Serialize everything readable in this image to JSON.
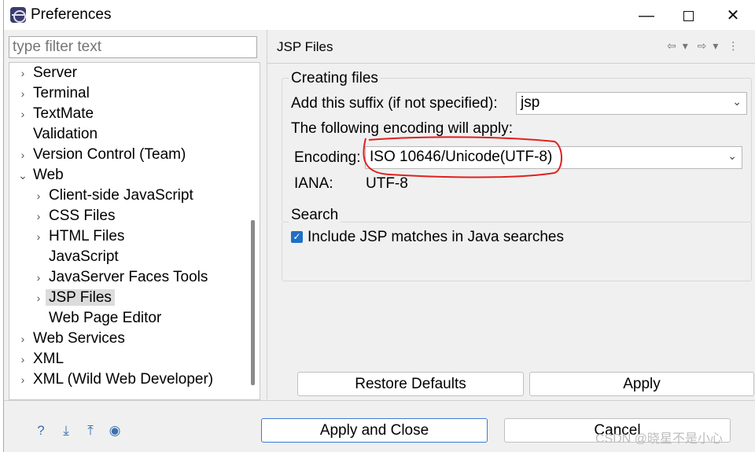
{
  "window": {
    "title": "Preferences"
  },
  "filter": {
    "placeholder": "type filter text"
  },
  "tree": [
    {
      "label": "Server",
      "expander": "›",
      "indent": 0
    },
    {
      "label": "Terminal",
      "expander": "›",
      "indent": 0
    },
    {
      "label": "TextMate",
      "expander": "›",
      "indent": 0
    },
    {
      "label": "Validation",
      "expander": "",
      "indent": 0
    },
    {
      "label": "Version Control (Team)",
      "expander": "›",
      "indent": 0
    },
    {
      "label": "Web",
      "expander": "⌄",
      "indent": 0
    },
    {
      "label": "Client-side JavaScript",
      "expander": "›",
      "indent": 1
    },
    {
      "label": "CSS Files",
      "expander": "›",
      "indent": 1
    },
    {
      "label": "HTML Files",
      "expander": "›",
      "indent": 1
    },
    {
      "label": "JavaScript",
      "expander": "",
      "indent": 1
    },
    {
      "label": "JavaServer Faces Tools",
      "expander": "›",
      "indent": 1
    },
    {
      "label": "JSP Files",
      "expander": "›",
      "indent": 1,
      "selected": true
    },
    {
      "label": "Web Page Editor",
      "expander": "",
      "indent": 1
    },
    {
      "label": "Web Services",
      "expander": "›",
      "indent": 0
    },
    {
      "label": "XML",
      "expander": "›",
      "indent": 0
    },
    {
      "label": "XML (Wild Web Developer)",
      "expander": "›",
      "indent": 0
    }
  ],
  "page": {
    "title": "JSP Files",
    "creating": {
      "group_label": "Creating files",
      "suffix_label": "Add this suffix (if not specified):",
      "suffix_value": "jsp",
      "encoding_intro": "The following encoding will apply:",
      "encoding_label": "Encoding:",
      "encoding_value": "ISO 10646/Unicode(UTF-8)",
      "iana_label": "IANA:",
      "iana_value": "UTF-8"
    },
    "search": {
      "group_label": "Search",
      "include_label": "Include JSP matches in Java searches",
      "include_checked": true
    },
    "restore_label": "Restore Defaults",
    "apply_label": "Apply"
  },
  "footer": {
    "apply_close_label": "Apply and Close",
    "cancel_label": "Cancel",
    "watermark": "CSDN @晓星不是小心"
  },
  "colors": {
    "accent": "#1f6fc5",
    "annotation": "#e02020"
  }
}
